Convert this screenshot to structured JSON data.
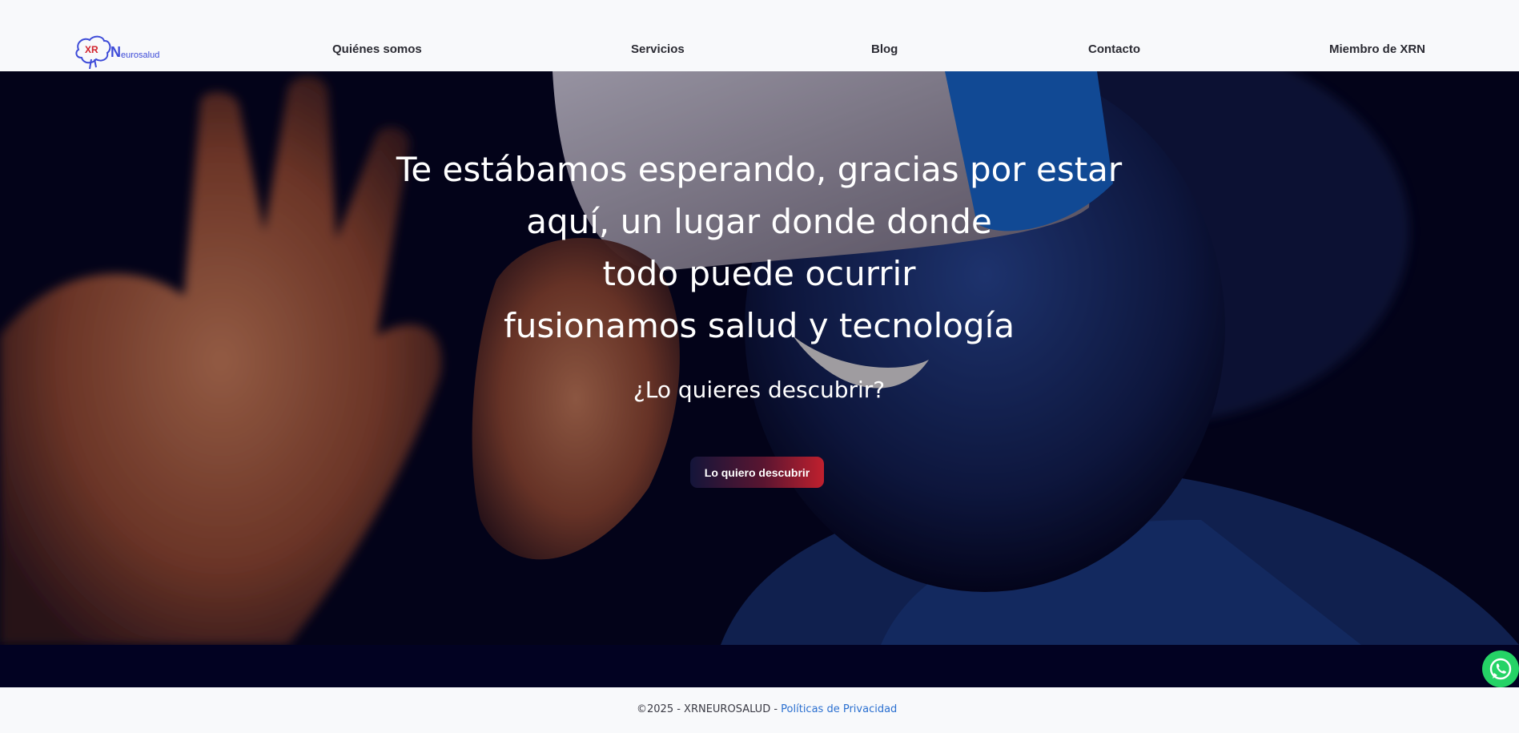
{
  "header": {
    "logo_text_xr": "XR",
    "logo_text_n": "N",
    "logo_text_rest": "eurosalud",
    "nav": [
      {
        "label": "Quiénes somos"
      },
      {
        "label": "Servicios"
      },
      {
        "label": "Blog"
      },
      {
        "label": "Contacto"
      },
      {
        "label": "Miembro de XRN"
      }
    ]
  },
  "hero": {
    "title_lines": [
      "Te estábamos esperando, gracias por estar",
      "aquí, un lugar donde donde",
      "todo puede ocurrir",
      "fusionamos salud y tecnología"
    ],
    "subtitle": "¿Lo quieres descubrir?",
    "cta_label": "Lo quiero descubrir"
  },
  "footer": {
    "copyright": "©2025 - XRNEUROSALUD - ",
    "privacy_link": "Políticas de Privacidad"
  },
  "colors": {
    "hero_bg": "#04041a",
    "cta_start": "#14153a",
    "cta_end": "#c0202e",
    "link": "#2a6fd0",
    "whatsapp": "#25d366"
  },
  "icons": {
    "whatsapp": "whatsapp-icon",
    "logo": "brain-cloud-logo"
  }
}
